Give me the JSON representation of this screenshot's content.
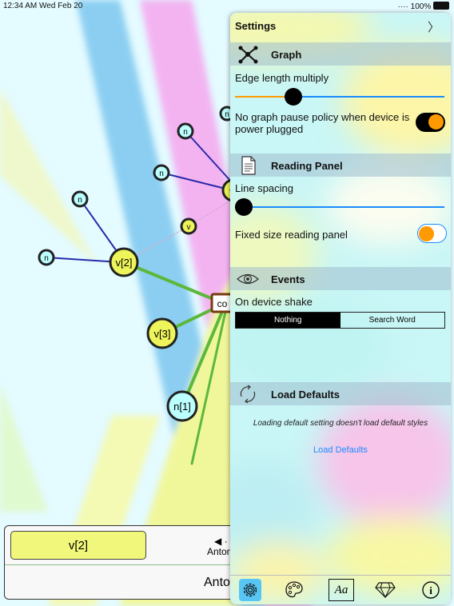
{
  "status_bar": {
    "time": "12:34 AM  Wed Feb 20",
    "battery": "····  100%"
  },
  "graph": {
    "nodes": [
      {
        "label": "n"
      },
      {
        "label": "n"
      },
      {
        "label": "n"
      },
      {
        "label": "n"
      },
      {
        "label": "n"
      },
      {
        "label": "v"
      },
      {
        "label": "v[2]"
      },
      {
        "label": "v[3]"
      },
      {
        "label": "n[1]"
      },
      {
        "label": "co"
      },
      {
        "label": "n"
      },
      {
        "label": "v"
      }
    ]
  },
  "bottom_panel": {
    "selected": "v[2]",
    "arrows": "◀ · ",
    "word_small": "Anton",
    "word_large": "Anton"
  },
  "settings": {
    "title": "Settings",
    "chevron": "〉",
    "graph": {
      "header": "Graph",
      "edge_label": "Edge length multiply",
      "edge_value": 0.28,
      "no_pause_label": "No graph pause policy when device is power plugged",
      "no_pause_on": true
    },
    "reading": {
      "header": "Reading Panel",
      "line_spacing_label": "Line spacing",
      "line_spacing_value": 0.0,
      "fixed_size_label": "Fixed size reading panel",
      "fixed_size_on": false
    },
    "events": {
      "header": "Events",
      "shake_label": "On device shake",
      "options": [
        "Nothing",
        "Search Word"
      ]
    },
    "defaults": {
      "header": "Load Defaults",
      "note": "Loading default setting doesn't load default styles",
      "link": "Load Defaults"
    },
    "tabs": [
      "gear-icon",
      "palette-icon",
      "font-icon",
      "diamond-icon",
      "info-icon"
    ],
    "accent": "#ff9900"
  }
}
